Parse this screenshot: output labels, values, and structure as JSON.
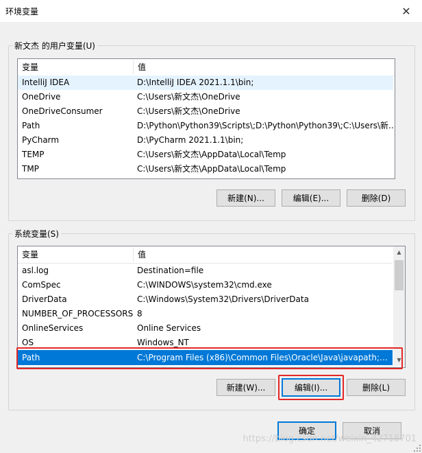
{
  "window": {
    "title": "环境变量",
    "close_glyph": "✕"
  },
  "user_section": {
    "label": "新文杰 的用户变量(U)",
    "columns": [
      "变量",
      "值"
    ],
    "rows": [
      {
        "name": "IntelliJ IDEA",
        "value": "D:\\IntelliJ IDEA 2021.1.1\\bin;"
      },
      {
        "name": "OneDrive",
        "value": "C:\\Users\\新文杰\\OneDrive"
      },
      {
        "name": "OneDriveConsumer",
        "value": "C:\\Users\\新文杰\\OneDrive"
      },
      {
        "name": "Path",
        "value": "D:\\Python\\Python39\\Scripts\\;D:\\Python\\Python39\\;C:\\Users\\新..."
      },
      {
        "name": "PyCharm",
        "value": "D:\\PyCharm 2021.1.1\\bin;"
      },
      {
        "name": "TEMP",
        "value": "C:\\Users\\新文杰\\AppData\\Local\\Temp"
      },
      {
        "name": "TMP",
        "value": "C:\\Users\\新文杰\\AppData\\Local\\Temp"
      }
    ],
    "buttons": {
      "new": "新建(N)...",
      "edit": "编辑(E)...",
      "delete": "删除(D)"
    }
  },
  "system_section": {
    "label": "系统变量(S)",
    "columns": [
      "变量",
      "值"
    ],
    "rows": [
      {
        "name": "asl.log",
        "value": "Destination=file"
      },
      {
        "name": "ComSpec",
        "value": "C:\\WINDOWS\\system32\\cmd.exe"
      },
      {
        "name": "DriverData",
        "value": "C:\\Windows\\System32\\Drivers\\DriverData"
      },
      {
        "name": "NUMBER_OF_PROCESSORS",
        "value": "8"
      },
      {
        "name": "OnlineServices",
        "value": "Online Services"
      },
      {
        "name": "OS",
        "value": "Windows_NT"
      },
      {
        "name": "Path",
        "value": "C:\\Program Files (x86)\\Common Files\\Oracle\\Java\\javapath;C:..."
      }
    ],
    "selected_row": "Path",
    "buttons": {
      "new": "新建(W)...",
      "edit": "编辑(I)...",
      "delete": "删除(L)"
    }
  },
  "footer": {
    "ok": "确定",
    "cancel": "取消"
  },
  "watermark": "https://blog.csdn.net/weixin_42718701",
  "colors": {
    "selection": "#0078d7",
    "highlight_box": "#e32626",
    "hover": "#e5f3ff"
  }
}
